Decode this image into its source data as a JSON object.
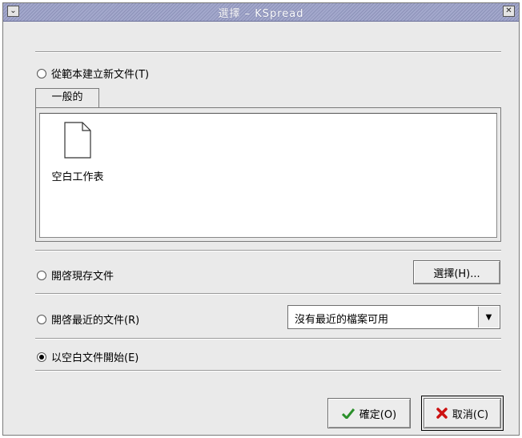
{
  "window": {
    "title": "選擇 – KSpread"
  },
  "titlebar": {
    "menu_glyph": "⌄",
    "close_glyph": "✕"
  },
  "template_option": {
    "label": "從範本建立新文件(T)"
  },
  "tabs": [
    {
      "label": "一般的"
    }
  ],
  "templates": [
    {
      "label": "空白工作表",
      "icon": "blank-document-icon"
    }
  ],
  "open_existing": {
    "label": "開啓現存文件",
    "button_label": "選擇(H)..."
  },
  "open_recent": {
    "label": "開啓最近的文件(R)",
    "combo_value": "沒有最近的檔案可用",
    "combo_arrow": "▼"
  },
  "blank_start": {
    "label": "以空白文件開始(E)",
    "checked": true
  },
  "buttons": {
    "ok_label": "確定(O)",
    "cancel_label": "取消(C)"
  },
  "colors": {
    "titlebar": "#a3a8cc",
    "ok_icon": "#2a8f2a",
    "cancel_icon": "#cc1111"
  }
}
